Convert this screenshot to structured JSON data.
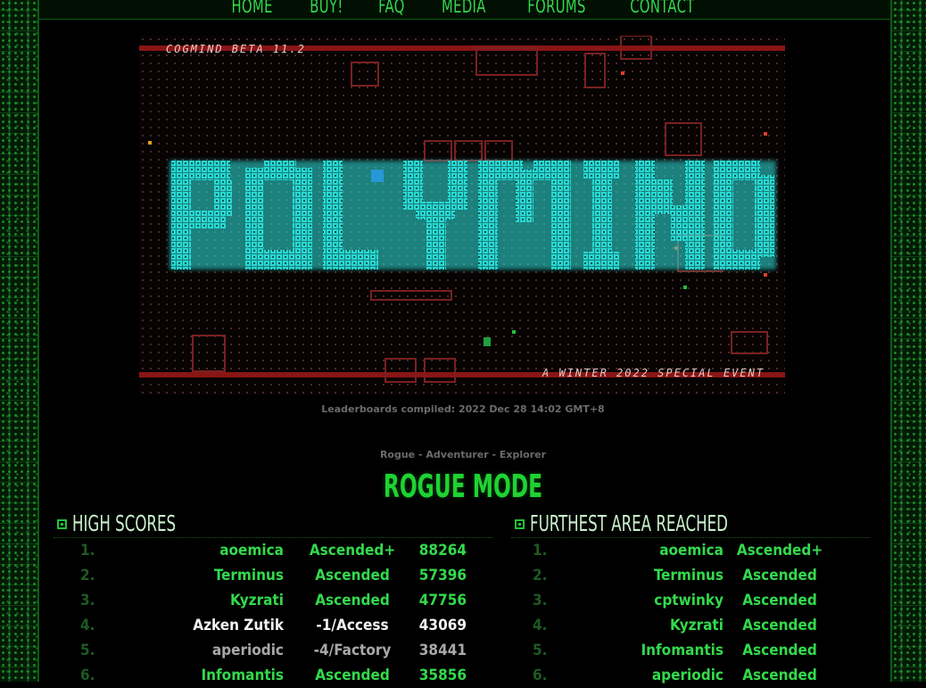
{
  "nav": [
    "HOME",
    "BUY!",
    "FAQ",
    "MEDIA",
    "FORUMS",
    "CONTACT"
  ],
  "banner": {
    "version": "COGMIND BETA 11.2",
    "event": "A WINTER 2022 SPECIAL EVENT",
    "logo_text": "POLYMIND"
  },
  "compiled": "Leaderboards compiled: 2022 Dec 28 14:02 GMT+8",
  "modes": [
    "Rogue",
    "Adventurer",
    "Explorer"
  ],
  "mode_title": "ROGUE MODE",
  "high_scores": {
    "title": "HIGH SCORES",
    "rows": [
      {
        "rank": "1.",
        "name": "aoemica",
        "status": "Ascended+",
        "score": "88264"
      },
      {
        "rank": "2.",
        "name": "Terminus",
        "status": "Ascended",
        "score": "57396"
      },
      {
        "rank": "3.",
        "name": "Kyzrati",
        "status": "Ascended",
        "score": "47756"
      },
      {
        "rank": "4.",
        "name": "Azken Zutik",
        "status": "-1/Access",
        "score": "43069"
      },
      {
        "rank": "5.",
        "name": "aperiodic",
        "status": "-4/Factory",
        "score": "38441"
      },
      {
        "rank": "6.",
        "name": "Infomantis",
        "status": "Ascended",
        "score": "35856"
      }
    ]
  },
  "furthest": {
    "title": "FURTHEST AREA REACHED",
    "rows": [
      {
        "rank": "1.",
        "name": "aoemica",
        "status": "Ascended+"
      },
      {
        "rank": "2.",
        "name": "Terminus",
        "status": "Ascended"
      },
      {
        "rank": "3.",
        "name": "cptwinky",
        "status": "Ascended"
      },
      {
        "rank": "4.",
        "name": "Kyzrati",
        "status": "Ascended"
      },
      {
        "rank": "5.",
        "name": "Infomantis",
        "status": "Ascended"
      },
      {
        "rank": "6.",
        "name": "aperiodic",
        "status": "Ascended"
      }
    ]
  },
  "colors": {
    "accent": "#33d94b",
    "banner_red": "#8a1515",
    "logo_cyan": "#2ee6e0"
  }
}
